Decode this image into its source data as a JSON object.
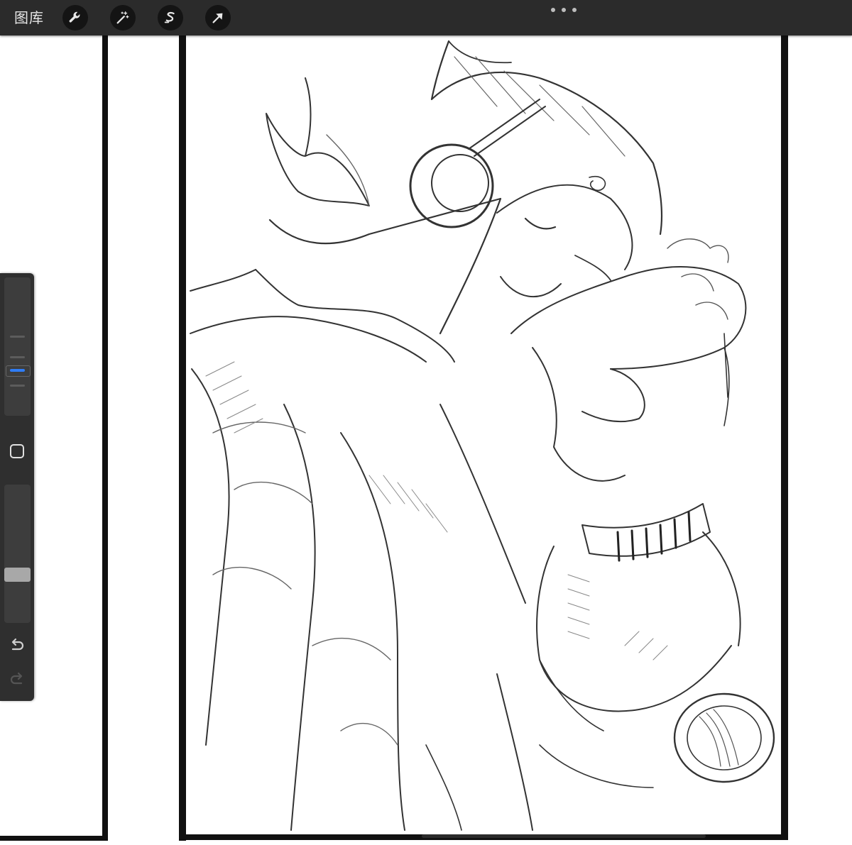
{
  "toolbar": {
    "gallery_label": "图库",
    "tools": [
      {
        "name": "actions",
        "icon": "wrench-icon"
      },
      {
        "name": "adjustments",
        "icon": "magic-wand-icon"
      },
      {
        "name": "selection",
        "icon": "selection-s-icon"
      },
      {
        "name": "transform",
        "icon": "arrow-cursor-icon"
      }
    ],
    "more_icon": "ellipsis-icon"
  },
  "sidebar": {
    "brush_size_slider_icon": "size-slider",
    "modify_icon": "square-icon",
    "opacity_slider_icon": "opacity-slider",
    "undo_icon": "undo-icon",
    "redo_icon": "redo-icon"
  },
  "colors": {
    "toolbar_bg": "#2b2b2b",
    "button_bg": "#141414",
    "accent": "#2f7df6",
    "canvas": "#ffffff",
    "line": "#111111"
  }
}
